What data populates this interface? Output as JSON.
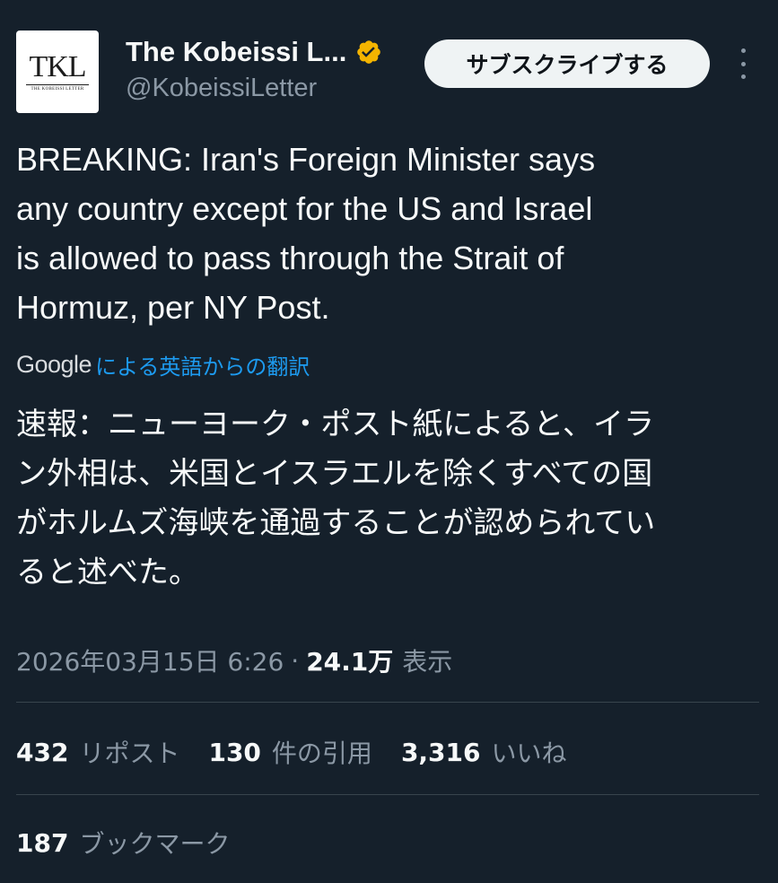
{
  "author": {
    "avatar_text": "TKL",
    "avatar_subtext": "THE KOBEISSI LETTER",
    "display_name": "The Kobeissi L...",
    "handle": "@KobeissiLetter",
    "verified_icon": "gold-verified-badge",
    "verified_color": "#f4b400"
  },
  "actions": {
    "subscribe_label": "サブスクライブする",
    "more_icon": "more-vertical-icon"
  },
  "tweet": {
    "text": "BREAKING: Iran's Foreign Minister says\nany country except for the US and Israel\nis allowed to pass through the Strait of\nHormuz, per NY Post.",
    "translation_provider": "Google",
    "translation_label": "による英語からの翻訳",
    "translated_text": "速報：ニューヨーク・ポスト紙によると、イラ\nン外相は、米国とイスラエルを除くすべての国\nがホルムズ海峡を通過することが認められてい\nると述べた。"
  },
  "meta": {
    "timestamp": "2026年03月15日 6:26",
    "separator": "·",
    "views_count": "24.1万",
    "views_label": "表示"
  },
  "stats": {
    "reposts_count": "432",
    "reposts_label": "リポスト",
    "quotes_count": "130",
    "quotes_label": "件の引用",
    "likes_count": "3,316",
    "likes_label": "いいね",
    "bookmarks_count": "187",
    "bookmarks_label": "ブックマーク"
  },
  "colors": {
    "background": "#15202b",
    "text_primary": "#f7f9f9",
    "text_secondary": "#8b98a5",
    "link": "#1d9bf0",
    "divider": "#38444d",
    "button_bg": "#eff3f4"
  }
}
